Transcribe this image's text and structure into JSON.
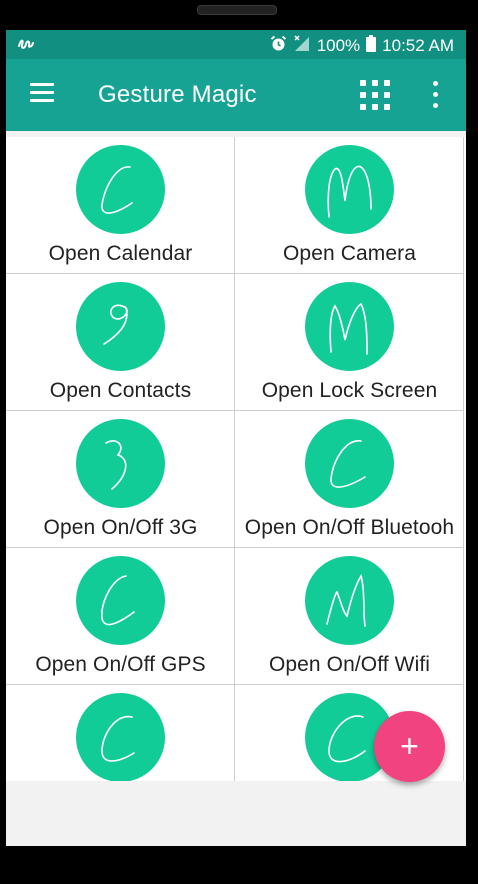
{
  "status_bar": {
    "battery": "100%",
    "time": "10:52 AM"
  },
  "app_bar": {
    "title": "Gesture Magic"
  },
  "gestures": [
    {
      "label": "Open Calendar"
    },
    {
      "label": "Open Camera"
    },
    {
      "label": "Open Contacts"
    },
    {
      "label": "Open Lock Screen"
    },
    {
      "label": "Open On/Off 3G"
    },
    {
      "label": "Open On/Off Bluetooh"
    },
    {
      "label": "Open On/Off GPS"
    },
    {
      "label": "Open On/Off Wifi"
    },
    {
      "label": ""
    },
    {
      "label": ""
    }
  ],
  "fab": {
    "label": "+"
  },
  "colors": {
    "status_bar": "#118f80",
    "app_bar": "#16a394",
    "gesture_circle": "#12cc98",
    "fab": "#f0437f"
  }
}
